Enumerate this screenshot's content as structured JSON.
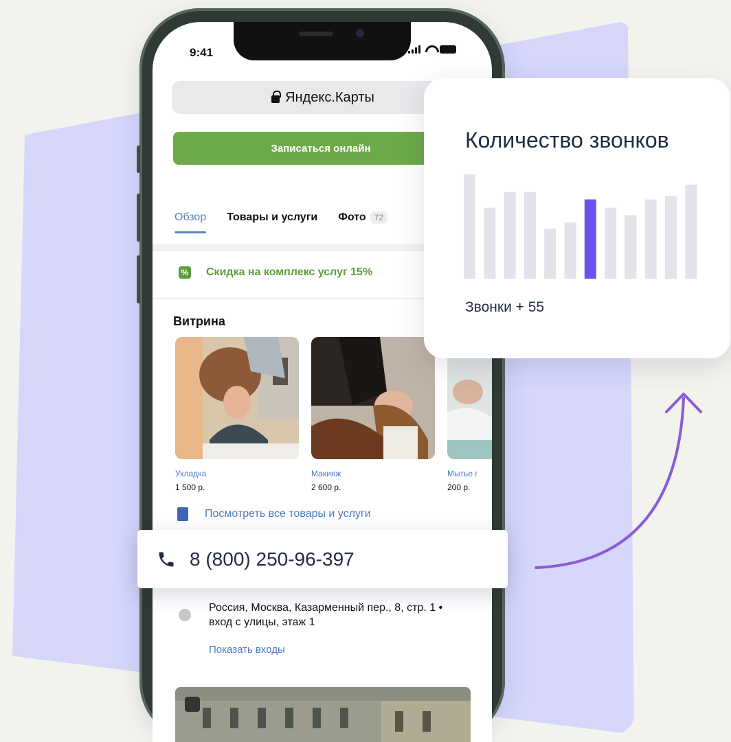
{
  "status_bar": {
    "time": "9:41"
  },
  "browser": {
    "url_label": "Яндекс.Карты"
  },
  "page": {
    "cta_label": "Записаться онлайн",
    "tabs": [
      {
        "label": "Обзор",
        "active": true
      },
      {
        "label": "Товары и услуги",
        "active": false
      },
      {
        "label": "Фото",
        "badge": "72",
        "active": false
      }
    ],
    "promo_text": "Скидка на комплекс услуг 15%",
    "vitrina_title": "Витрина",
    "products": [
      {
        "name": "Укладка",
        "price": "1 500 р."
      },
      {
        "name": "Макияж",
        "price": "2 600 р."
      },
      {
        "name": "Мытье г",
        "price": "200 р."
      }
    ],
    "see_all_label": "Посмотреть все товары и услуги",
    "address_line1": "Россия, Москва, Казарменный пер., 8, стр. 1 •",
    "address_line2": "вход с улицы, этаж 1",
    "show_entries_label": "Показать входы"
  },
  "phone_card": {
    "number": "8 (800) 250-96-397"
  },
  "stats_card": {
    "title": "Количество звонков",
    "caption": "Звонки + 55"
  },
  "chart_data": {
    "type": "bar",
    "categories": [
      "1",
      "2",
      "3",
      "4",
      "5",
      "6",
      "7",
      "8",
      "9",
      "10",
      "11",
      "12"
    ],
    "values": [
      100,
      68,
      83,
      83,
      48,
      54,
      76,
      68,
      61,
      76,
      79,
      90
    ],
    "highlight_index": 6,
    "bar_color": "#e3e3ec",
    "highlight_color": "#6c4fef"
  },
  "colors": {
    "accent_green": "#6daa48",
    "link_blue": "#4d78c6",
    "background_lavender": "#d6d7fb",
    "arrow_purple": "#8a5bd8"
  }
}
